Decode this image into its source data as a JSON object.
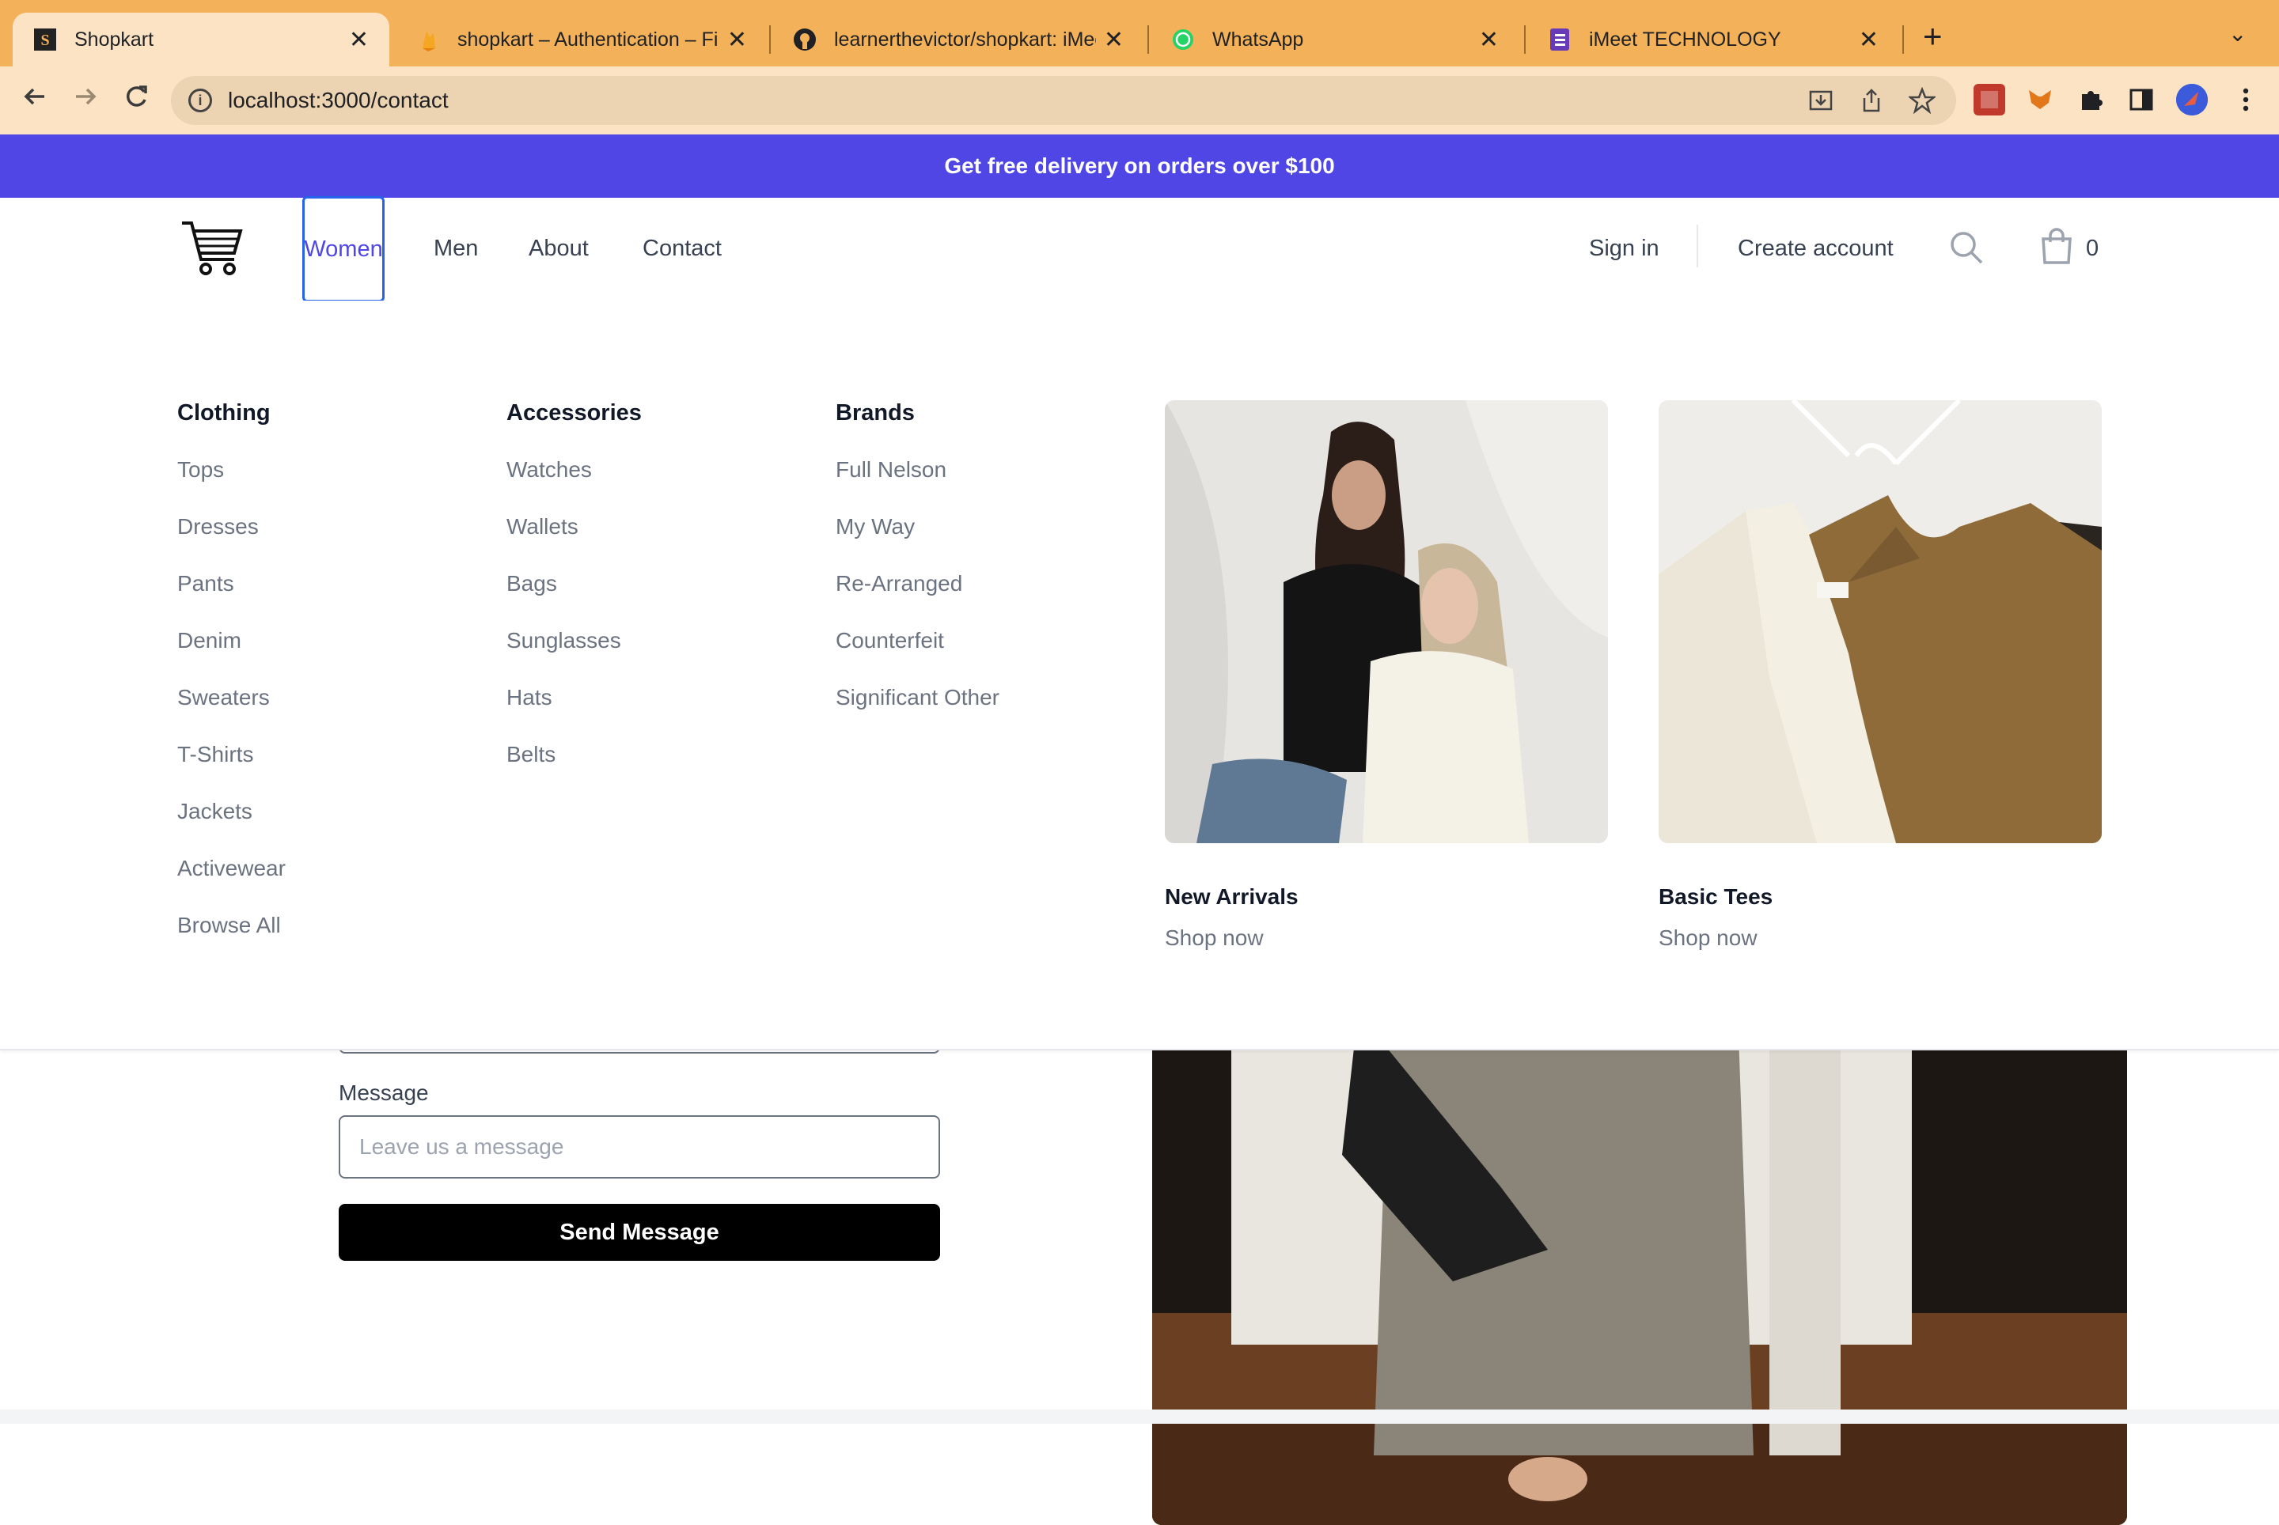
{
  "browser": {
    "tabs": [
      {
        "title": "Shopkart",
        "icon": "shopkart-favicon"
      },
      {
        "title": "shopkart – Authentication – Fir",
        "icon": "firebase-favicon"
      },
      {
        "title": "learnerthevictor/shopkart: iMee",
        "icon": "github-favicon"
      },
      {
        "title": "WhatsApp",
        "icon": "whatsapp-favicon"
      },
      {
        "title": "iMeet TECHNOLOGY",
        "icon": "forms-favicon"
      }
    ],
    "url": "localhost:3000/contact",
    "tab_close_glyph": "✕",
    "new_tab_glyph": "+",
    "tab_menu_glyph": "⌄"
  },
  "promo": {
    "text": "Get free delivery on orders over $100"
  },
  "nav": {
    "links": [
      "Women",
      "Men",
      "About",
      "Contact"
    ],
    "sign_in": "Sign in",
    "create_account": "Create account",
    "cart_count": "0"
  },
  "mega_menu": {
    "columns": [
      {
        "heading": "Clothing",
        "items": [
          "Tops",
          "Dresses",
          "Pants",
          "Denim",
          "Sweaters",
          "T-Shirts",
          "Jackets",
          "Activewear",
          "Browse All"
        ]
      },
      {
        "heading": "Accessories",
        "items": [
          "Watches",
          "Wallets",
          "Bags",
          "Sunglasses",
          "Hats",
          "Belts"
        ]
      },
      {
        "heading": "Brands",
        "items": [
          "Full Nelson",
          "My Way",
          "Re-Arranged",
          "Counterfeit",
          "Significant Other"
        ]
      }
    ],
    "featured": [
      {
        "title": "New Arrivals",
        "cta": "Shop now"
      },
      {
        "title": "Basic Tees",
        "cta": "Shop now"
      }
    ]
  },
  "contact_form": {
    "message_label": "Message",
    "message_placeholder": "Leave us a message",
    "submit_label": "Send Message"
  },
  "colors": {
    "promo_bg": "#4f46e5",
    "accent": "#4f46e5",
    "tabbar_bg": "#f3b15a",
    "toolbar_bg": "#fbe3c4",
    "button_bg": "#000000"
  }
}
